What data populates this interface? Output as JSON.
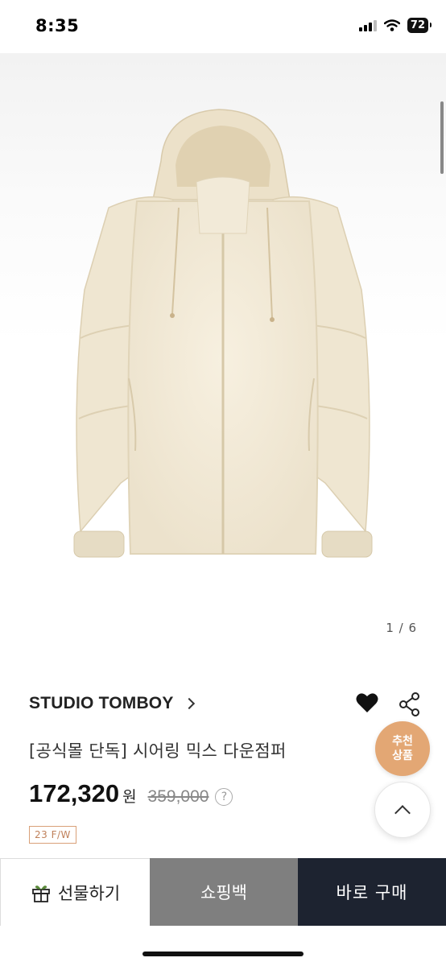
{
  "status_bar": {
    "time": "8:35",
    "battery": "72"
  },
  "gallery": {
    "counter": "1 / 6"
  },
  "product": {
    "brand": "STUDIO TOMBOY",
    "title": "[공식몰 단독] 시어링 믹스 다운점퍼",
    "price": "172,320",
    "currency": "원",
    "original_price": "359,000",
    "help": "?",
    "season": "23 F/W"
  },
  "floating": {
    "recommend_line1": "추천",
    "recommend_line2": "상품"
  },
  "actions": {
    "gift": "선물하기",
    "cart": "쇼핑백",
    "buy": "바로 구매"
  },
  "colors": {
    "accent": "#e3a774",
    "buy_bg": "#1d2330",
    "cart_bg": "#7f7f7f",
    "badge": "#c0805a"
  },
  "icons": [
    "signal-icon",
    "wifi-icon",
    "battery-icon",
    "chevron-right-icon",
    "heart-icon",
    "share-icon",
    "help-icon",
    "gift-icon",
    "chevron-up-icon"
  ]
}
